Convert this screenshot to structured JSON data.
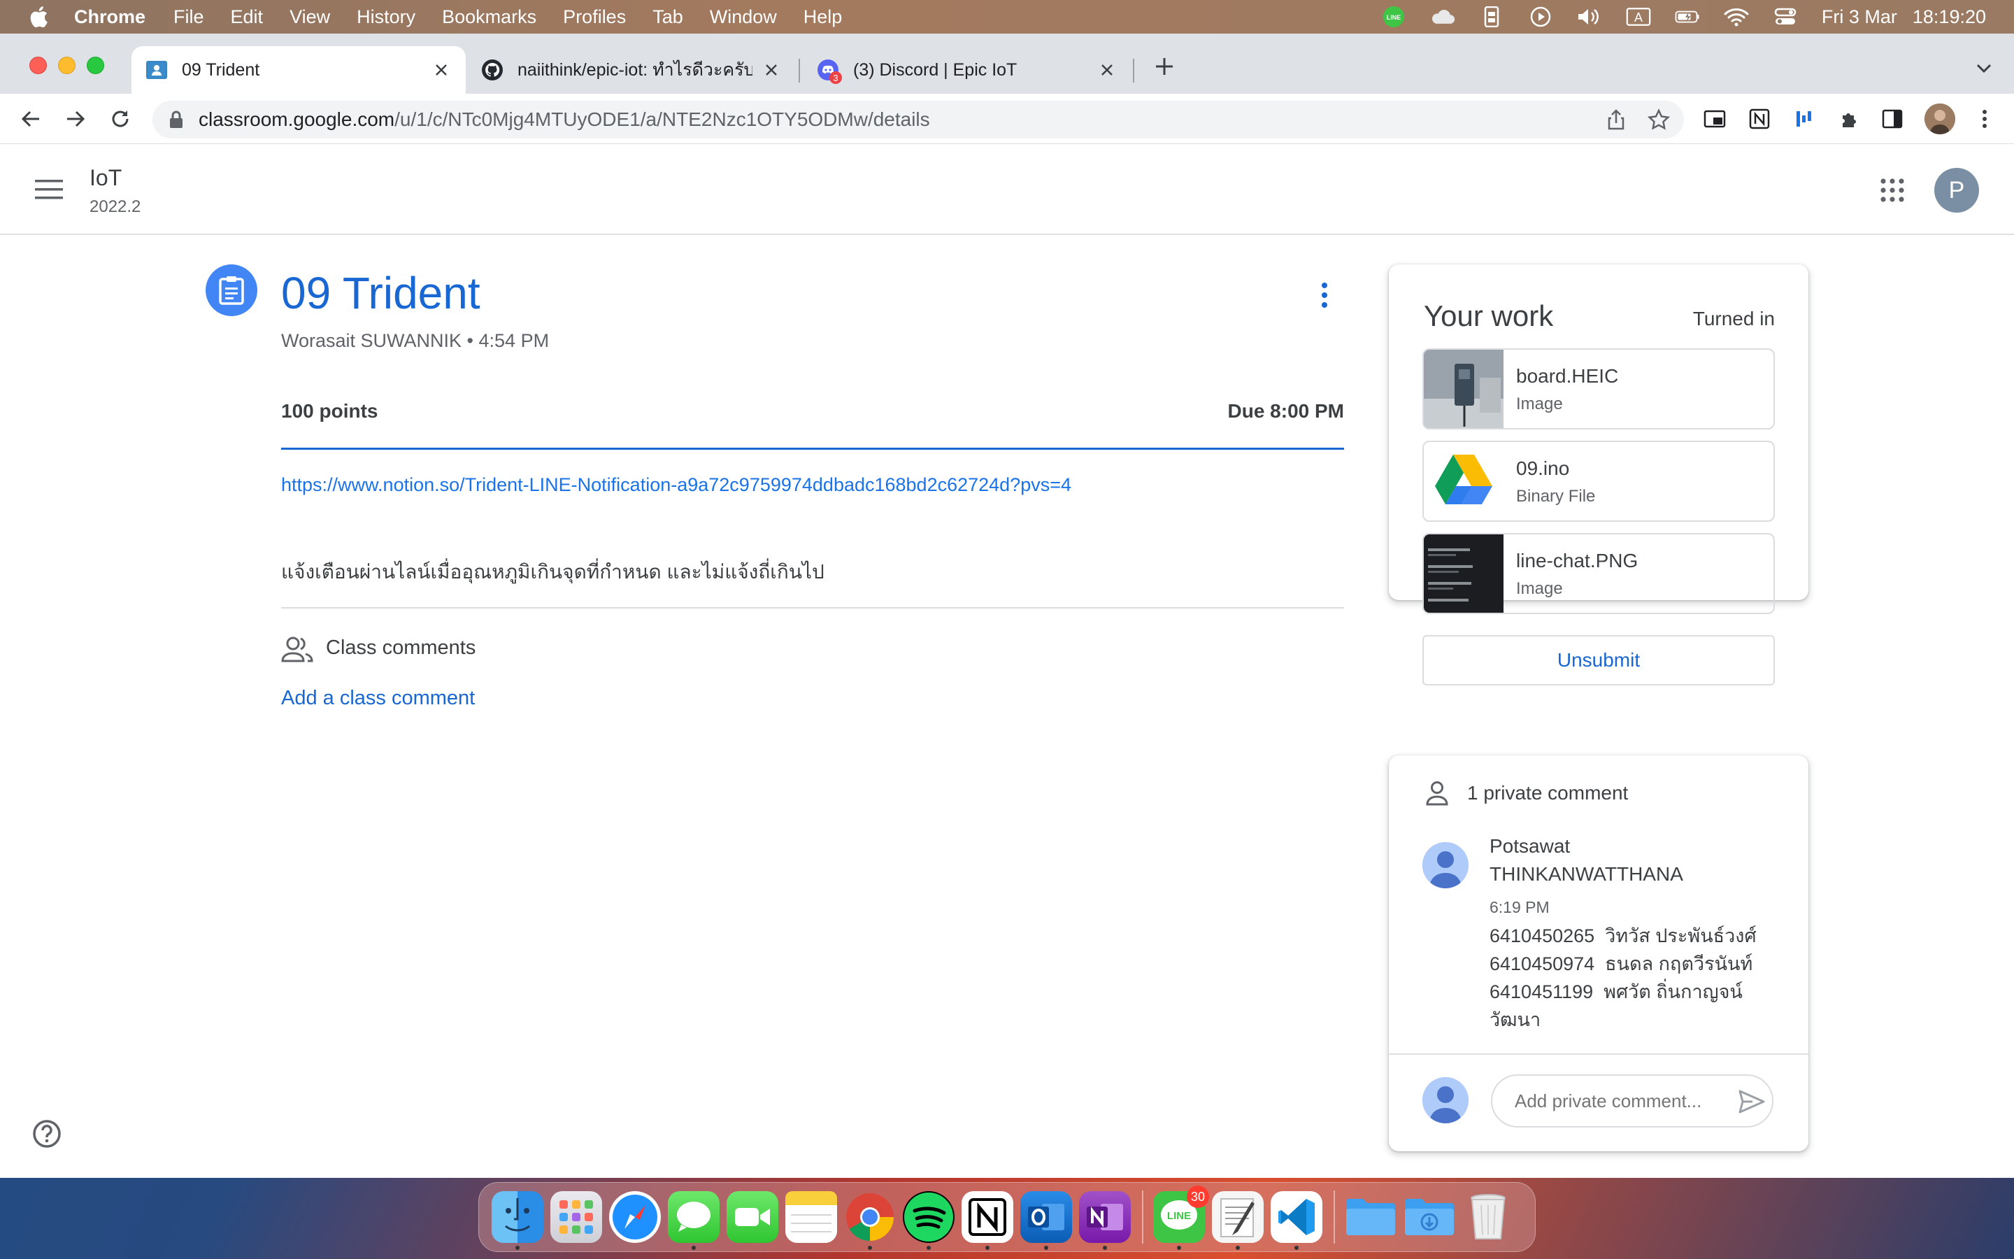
{
  "menubar": {
    "app_name": "Chrome",
    "items": [
      "File",
      "Edit",
      "View",
      "History",
      "Bookmarks",
      "Profiles",
      "Tab",
      "Window",
      "Help"
    ],
    "date": "Fri 3 Mar",
    "time": "18:19:20",
    "status_icons": [
      "line-icon",
      "cloud-icon",
      "battery-phone-icon",
      "play-icon",
      "volume-icon",
      "input-source-icon",
      "battery-icon",
      "wifi-icon",
      "control-center-icon"
    ],
    "input_source": "A"
  },
  "browser": {
    "tabs": [
      {
        "title": "09 Trident",
        "active": true,
        "icon": "classroom-icon"
      },
      {
        "title": "naiithink/epic-iot: ทำไรดีวะครับ",
        "active": false,
        "icon": "github-icon"
      },
      {
        "title": "(3) Discord | Epic IoT",
        "active": false,
        "icon": "discord-icon",
        "badge": "3"
      }
    ],
    "url_host": "classroom.google.com",
    "url_path": "/u/1/c/NTc0Mjg4MTUyODE1/a/NTE2Nzc1OTY5ODMw/details"
  },
  "classroom": {
    "class_name": "IoT",
    "class_section": "2022.2",
    "avatar_letter": "P",
    "assignment": {
      "title": "09 Trident",
      "author": "Worasait SUWANNIK",
      "separator": " • ",
      "posted_time": "4:54 PM",
      "points": "100 points",
      "due": "Due 8:00 PM",
      "link": "https://www.notion.so/Trident-LINE-Notification-a9a72c9759974ddbadc168bd2c62724d?pvs=4",
      "description": "แจ้งเตือนผ่านไลน์เมื่ออุณหภูมิเกินจุดที่กำหนด และไม่แจ้งถี่เกินไป"
    },
    "class_comments": {
      "label": "Class comments",
      "add_label": "Add a class comment"
    },
    "your_work": {
      "title": "Your work",
      "status": "Turned in",
      "files": [
        {
          "name": "board.HEIC",
          "type": "Image"
        },
        {
          "name": "09.ino",
          "type": "Binary File"
        },
        {
          "name": "line-chat.PNG",
          "type": "Image"
        }
      ],
      "unsubmit_label": "Unsubmit"
    },
    "private_comments": {
      "label": "1 private comment",
      "author_line1": "Potsawat",
      "author_line2": "THINKANWATTHANA",
      "time": "6:19 PM",
      "lines": [
        "6410450265  วิทวัส ประพันธ์วงศ์",
        "6410450974  ธนดล กฤตวีรนันท์",
        "6410451199  พศวัต ถิ่นกาญจน์",
        "วัฒนา"
      ],
      "input_placeholder": "Add private comment..."
    }
  },
  "dock": {
    "apps": [
      "finder-icon",
      "launchpad-icon",
      "safari-icon",
      "messages-icon",
      "facetime-icon",
      "notes-icon",
      "chrome-icon",
      "spotify-icon",
      "notion-icon",
      "outlook-icon",
      "onenote-icon",
      "line-icon",
      "textedit-icon",
      "vscode-icon",
      "folder-icon",
      "downloads-icon",
      "trash-icon"
    ],
    "line_badge": "30"
  }
}
